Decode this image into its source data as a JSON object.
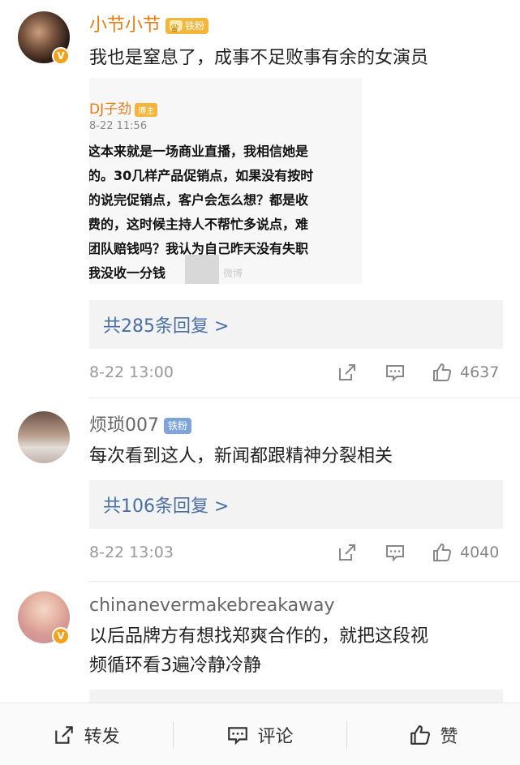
{
  "comments": [
    {
      "username": "小节小节",
      "badge": "铁粉",
      "text": "我也是窒息了，成事不足败事有余的女演员",
      "quote": {
        "user": "DJ子劲",
        "user_badge": "博主",
        "time": "8-22 11:56",
        "lines": [
          "这本来就是一场商业直播，我相信她是",
          "的。30几样产品促销点，如果没有按时",
          "的说完促销点，客户会怎么想？都是收",
          "费的，这时候主持人不帮忙多说点，难",
          "团队赔钱吗？我认为自己昨天没有失职",
          "我没收一分钱"
        ],
        "watermark": "微博"
      },
      "replies": "共285条回复 >",
      "time": "8-22 13:00",
      "likes": "4637"
    },
    {
      "username": "烦琐007",
      "badge": "铁粉",
      "text": "每次看到这人，新闻都跟精神分裂相关",
      "replies": "共106条回复 >",
      "time": "8-22 13:03",
      "likes": "4040"
    },
    {
      "username": "chinanevermakebreakaway",
      "text_line1": "以后品牌方有想找郑爽合作的，就把这段视",
      "text_line2": "频循环看3遍冷静冷静"
    }
  ],
  "bottom_bar": {
    "repost": "转发",
    "comment": "评论",
    "like": "赞"
  },
  "colors": {
    "username_orange": "#e97b14",
    "link_blue": "#4a6fa5",
    "vip_badge": "#f4a11a"
  }
}
